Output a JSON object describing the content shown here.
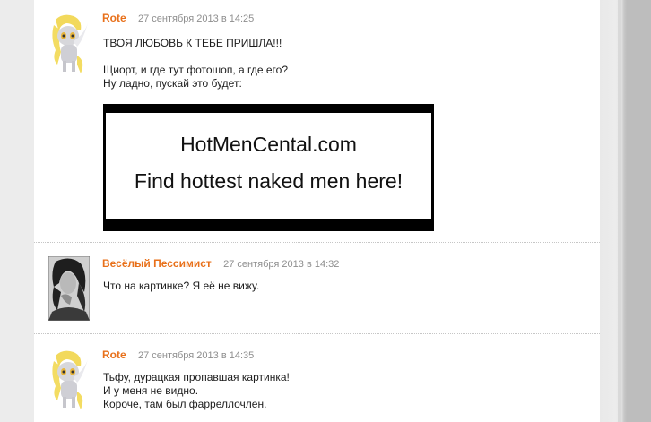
{
  "comments": [
    {
      "author": "Rote",
      "date": "27 сентября 2013 в 14:25",
      "avatar": "pony-avatar",
      "lines": [
        "ТВОЯ ЛЮБОВЬ К ТЕБЕ ПРИШЛА!!!",
        "",
        "Щиорт, и где тут фотошоп, а где его?",
        "Ну ладно, пускай это будет:"
      ],
      "image": {
        "line1": "HotMenCental.com",
        "line2": "Find hottest naked men here!"
      }
    },
    {
      "author": "Весёлый Пессимист",
      "date": "27 сентября 2013 в 14:32",
      "avatar": "photo-avatar",
      "lines": [
        "Что на картинке? Я её не вижу."
      ]
    },
    {
      "author": "Rote",
      "date": "27 сентября 2013 в 14:35",
      "avatar": "pony-avatar",
      "lines": [
        "Тьфу, дурацкая пропавшая картинка!",
        "И у меня не видно.",
        "Короче, там был фарреллочлен."
      ]
    }
  ],
  "colors": {
    "author": "#e8701a",
    "date": "#8e8e8e",
    "text": "#1c1c1c"
  }
}
